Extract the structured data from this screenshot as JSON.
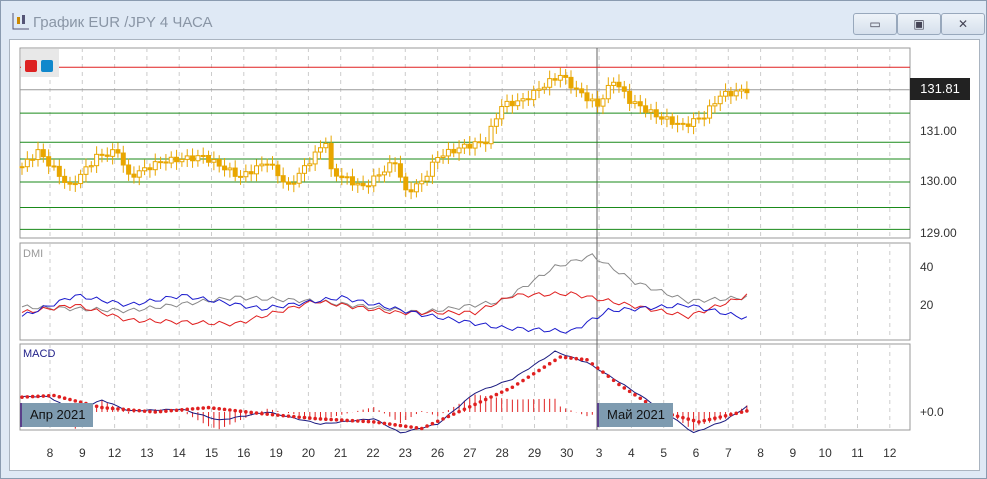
{
  "window": {
    "title": "График EUR /JPY  4 ЧАСА",
    "minimize": "▭",
    "maximize": "▣",
    "close": "✕"
  },
  "chart_data": {
    "type": "candlestick",
    "symbol": "EUR/JPY",
    "timeframe": "4 ЧАСА",
    "price_axis": {
      "ticks": [
        "131.00",
        "130.00",
        "129.00"
      ],
      "range": [
        128.95,
        132.6
      ]
    },
    "last_price": "131.81",
    "red_level": 132.25,
    "green_levels": [
      131.35,
      130.78,
      130.45,
      130.0,
      129.5,
      129.07
    ],
    "price_path": [
      [
        0,
        130.3
      ],
      [
        3,
        130.6
      ],
      [
        9,
        129.9
      ],
      [
        14,
        130.5
      ],
      [
        18,
        130.6
      ],
      [
        20,
        130.1
      ],
      [
        26,
        130.4
      ],
      [
        34,
        130.5
      ],
      [
        41,
        130.1
      ],
      [
        46,
        130.4
      ],
      [
        50,
        129.9
      ],
      [
        57,
        130.8
      ],
      [
        58,
        130.2
      ],
      [
        64,
        129.9
      ],
      [
        70,
        130.4
      ],
      [
        72,
        129.8
      ],
      [
        75,
        130.0
      ],
      [
        78,
        130.5
      ],
      [
        83,
        130.7
      ],
      [
        87,
        130.8
      ],
      [
        90,
        131.5
      ],
      [
        94,
        131.6
      ],
      [
        98,
        131.9
      ],
      [
        101,
        132.1
      ],
      [
        104,
        131.8
      ],
      [
        108,
        131.5
      ],
      [
        111,
        132.0
      ],
      [
        114,
        131.6
      ],
      [
        119,
        131.3
      ],
      [
        124,
        131.1
      ],
      [
        128,
        131.3
      ],
      [
        131,
        131.7
      ],
      [
        136,
        131.81
      ]
    ],
    "dmi": {
      "label": "DMI",
      "ticks": [
        "40",
        "20"
      ],
      "adx": [
        [
          0,
          19
        ],
        [
          20,
          17
        ],
        [
          40,
          24
        ],
        [
          55,
          22
        ],
        [
          75,
          16
        ],
        [
          90,
          22
        ],
        [
          100,
          40
        ],
        [
          107,
          46
        ],
        [
          115,
          32
        ],
        [
          125,
          22
        ],
        [
          136,
          24
        ]
      ],
      "plus_di": [
        [
          0,
          16
        ],
        [
          10,
          20
        ],
        [
          20,
          12
        ],
        [
          40,
          10
        ],
        [
          55,
          22
        ],
        [
          70,
          16
        ],
        [
          85,
          16
        ],
        [
          92,
          25
        ],
        [
          103,
          26
        ],
        [
          112,
          21
        ],
        [
          125,
          14
        ],
        [
          136,
          25
        ]
      ],
      "minus_di": [
        [
          0,
          14
        ],
        [
          10,
          25
        ],
        [
          20,
          20
        ],
        [
          30,
          25
        ],
        [
          45,
          18
        ],
        [
          60,
          24
        ],
        [
          75,
          15
        ],
        [
          90,
          8
        ],
        [
          103,
          6
        ],
        [
          110,
          17
        ],
        [
          125,
          20
        ],
        [
          136,
          13
        ]
      ]
    },
    "macd": {
      "label": "MACD",
      "zero_tick": "+0.0",
      "line": [
        [
          0,
          0.28
        ],
        [
          5,
          0.28
        ],
        [
          10,
          0.0
        ],
        [
          15,
          0.22
        ],
        [
          20,
          0.02
        ],
        [
          30,
          0.05
        ],
        [
          37,
          -0.15
        ],
        [
          46,
          -0.0
        ],
        [
          56,
          -0.22
        ],
        [
          66,
          -0.12
        ],
        [
          71,
          -0.38
        ],
        [
          78,
          -0.22
        ],
        [
          85,
          0.35
        ],
        [
          92,
          0.6
        ],
        [
          100,
          1.1
        ],
        [
          106,
          0.9
        ],
        [
          112,
          0.55
        ],
        [
          120,
          0.05
        ],
        [
          126,
          -0.38
        ],
        [
          132,
          -0.15
        ],
        [
          136,
          0.1
        ]
      ],
      "signal": [
        [
          0,
          0.27
        ],
        [
          6,
          0.3
        ],
        [
          15,
          0.08
        ],
        [
          25,
          0.0
        ],
        [
          35,
          0.08
        ],
        [
          45,
          -0.03
        ],
        [
          55,
          -0.12
        ],
        [
          66,
          -0.18
        ],
        [
          75,
          -0.3
        ],
        [
          83,
          0.05
        ],
        [
          92,
          0.45
        ],
        [
          101,
          1.0
        ],
        [
          106,
          0.95
        ],
        [
          112,
          0.5
        ],
        [
          120,
          0.0
        ],
        [
          127,
          -0.18
        ],
        [
          136,
          0.02
        ]
      ]
    },
    "x_ticks": [
      "8",
      "9",
      "12",
      "13",
      "14",
      "15",
      "16",
      "19",
      "20",
      "21",
      "22",
      "23",
      "26",
      "27",
      "28",
      "29",
      "30",
      "3",
      "4",
      "5",
      "6",
      "7",
      "8",
      "9",
      "10",
      "11",
      "12"
    ],
    "period_labels": [
      "Апр 2021",
      "Май 2021"
    ]
  },
  "colors": {
    "candle": "#e8a600",
    "red": "#e02020",
    "green": "#1a8a1a",
    "blue": "#1a1acc",
    "gray": "#888888"
  }
}
